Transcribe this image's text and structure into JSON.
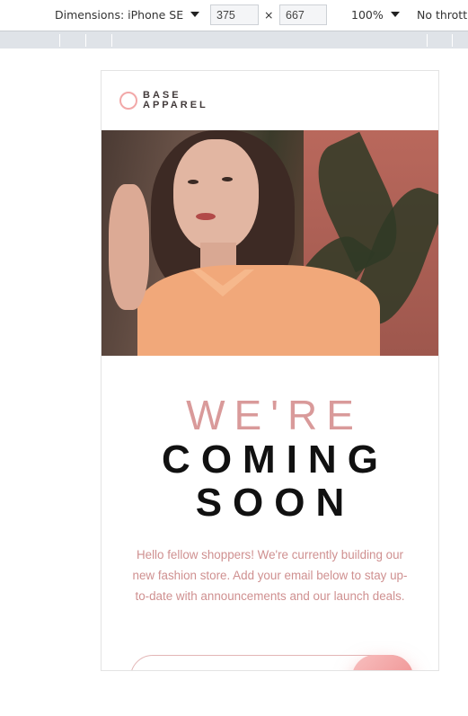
{
  "devtools": {
    "device_label": "Dimensions: iPhone SE",
    "width_value": "375",
    "height_value": "667",
    "times_sign": "×",
    "zoom": "100%",
    "throttle": "No throttl"
  },
  "site": {
    "logo_line1": "BASE",
    "logo_line2": "APPAREL",
    "headline_light": "WE'RE",
    "headline_bold_1": "COMING",
    "headline_bold_2": "SOON",
    "description": "Hello fellow shoppers! We're currently building our new fashion store. Add your email below to stay up-to-date with announcements and our launch deals.",
    "email_placeholder": "",
    "submit_icon": "arrow-right-icon",
    "submit_glyph": "›"
  },
  "colors": {
    "accent": "#ee8c8c",
    "text_pink": "#cf9090",
    "headline_light": "#d99a9a",
    "headline_dark": "#111111"
  }
}
